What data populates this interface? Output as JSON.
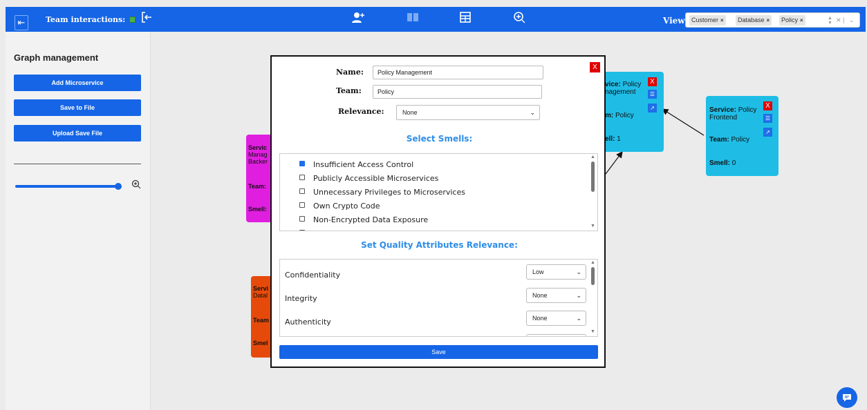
{
  "topbar": {
    "team_interactions_label": "Team interactions:",
    "view_label": "View:",
    "view_tags": [
      "Customer",
      "Database",
      "Policy"
    ],
    "remove_glyph": "×",
    "icons": [
      "arrow-left-bar-icon",
      "logout-icon",
      "add-user-icon",
      "team-layout-icon",
      "table-icon",
      "zoom-in-icon"
    ]
  },
  "sidebar": {
    "title": "Graph management",
    "buttons": [
      "Add Microservice",
      "Save to File",
      "Upload Save File"
    ]
  },
  "nodes": {
    "policy_frontend": {
      "service_label": "Service:",
      "service_name": "Policy Frontend",
      "team_label": "Team:",
      "team": "Policy",
      "smell_label": "Smell:",
      "smell": "0",
      "color": "#1fbde6"
    },
    "policy_management": {
      "service_label": "vice:",
      "service_name": "Policy",
      "service_name_2": "nagement",
      "team_label": "m:",
      "team": "Policy",
      "smell_label": "ell:",
      "smell": "1",
      "color": "#1fbde6"
    },
    "policy_backend": {
      "service_label": "Servic",
      "line2": "Manag",
      "line3": "Backer",
      "team_label": "Team:",
      "smell_label": "Smell:",
      "color": "#e01ee0"
    },
    "database": {
      "service_label": "Servi",
      "line2": "Datal",
      "team_label": "Team",
      "smell_label": "Smel",
      "color": "#e64a0a"
    }
  },
  "modal": {
    "close_label": "X",
    "name_label": "Name:",
    "name_value": "Policy Management",
    "team_label": "Team:",
    "team_value": "Policy",
    "relevance_label": "Relevance:",
    "relevance_value": "None",
    "select_smells_heading": "Select Smells:",
    "smells": [
      {
        "label": "Insufficient Access Control",
        "checked": true
      },
      {
        "label": "Publicly Accessible Microservices",
        "checked": false
      },
      {
        "label": "Unnecessary Privileges to Microservices",
        "checked": false
      },
      {
        "label": "Own Crypto Code",
        "checked": false
      },
      {
        "label": "Non-Encrypted Data Exposure",
        "checked": false
      }
    ],
    "qa_heading": "Set Quality Attributes Relevance:",
    "quality_attributes": [
      {
        "label": "Confidentiality",
        "value": "Low"
      },
      {
        "label": "Integrity",
        "value": "None"
      },
      {
        "label": "Authenticity",
        "value": "None"
      }
    ],
    "save_label": "Save"
  },
  "colors": {
    "primary": "#1565e6",
    "heading": "#2e8ee8",
    "danger": "#e00000"
  }
}
